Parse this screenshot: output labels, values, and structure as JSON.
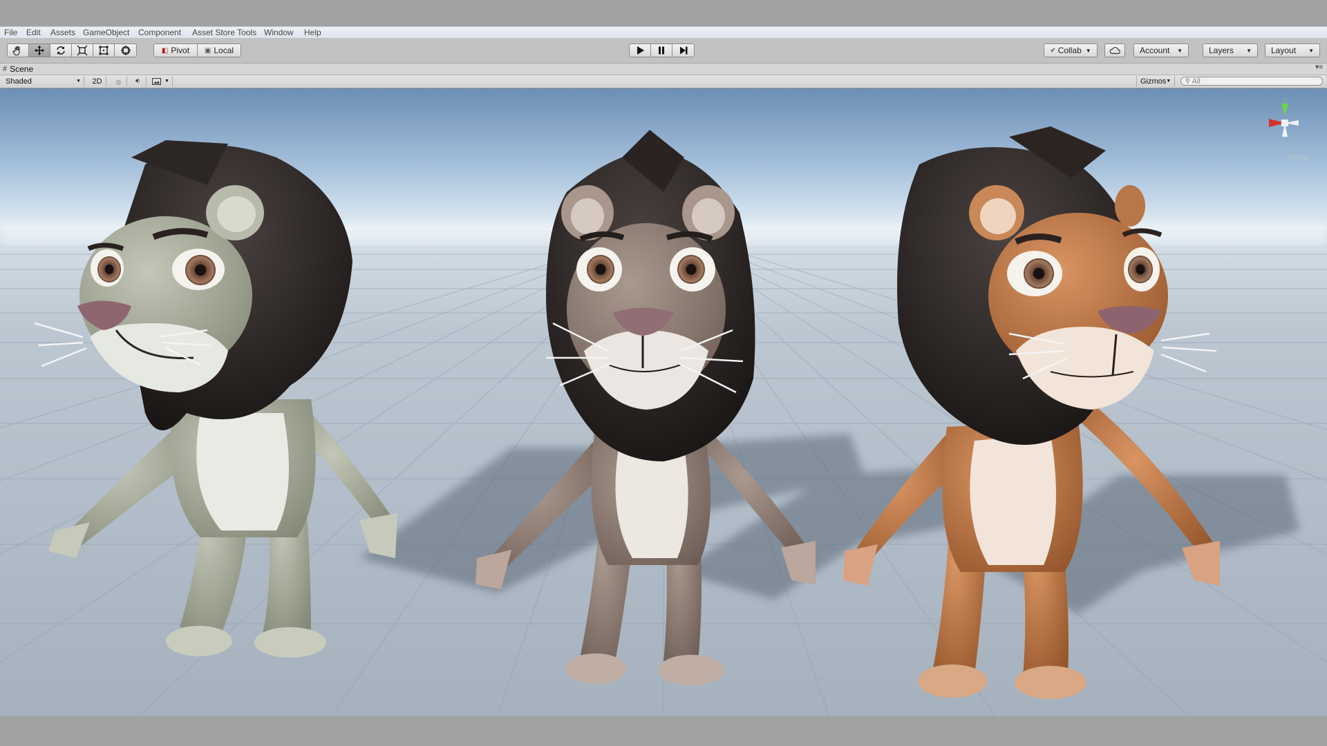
{
  "menubar": {
    "items": [
      "File",
      "Edit",
      "Assets",
      "GameObject",
      "Component",
      "Asset Store Tools",
      "Window",
      "Help"
    ]
  },
  "toolbar": {
    "tools": [
      "hand-tool",
      "move-tool",
      "rotate-tool",
      "scale-tool",
      "rect-tool",
      "transform-tool"
    ],
    "active_tool": "move-tool",
    "pivot_label": "Pivot",
    "local_label": "Local",
    "play_controls": [
      "play",
      "pause",
      "step"
    ],
    "collab_label": "Collab",
    "account_label": "Account",
    "layers_label": "Layers",
    "layout_label": "Layout"
  },
  "scene_tab": {
    "label": "Scene"
  },
  "scene_toolbar": {
    "shading_mode": "Shaded",
    "mode_2d": "2D",
    "gizmos_label": "Gizmos",
    "search_placeholder": "All"
  },
  "scene_view": {
    "projection": "Persp",
    "gizmo_axis_y": "y",
    "characters": [
      {
        "name": "lion-grey",
        "fur": "#9ea08f",
        "belly": "#e6e8e2",
        "mane": "#2a2523",
        "nose": "#8e6670"
      },
      {
        "name": "lion-brown",
        "fur": "#8e7c72",
        "belly": "#ece6e2",
        "mane": "#231e1c",
        "nose": "#916d74"
      },
      {
        "name": "lion-orange",
        "fur": "#b7703e",
        "belly": "#f1e4d8",
        "mane": "#2b2220",
        "nose": "#8d6370"
      }
    ]
  },
  "colors": {
    "editor_bg": "#c2c2c2",
    "sky_top": "#6f8fb5",
    "horizon": "#dce8f0",
    "ground": "#aab5c1",
    "gizmo_x": "#d8302a",
    "gizmo_y": "#6ad64a"
  }
}
